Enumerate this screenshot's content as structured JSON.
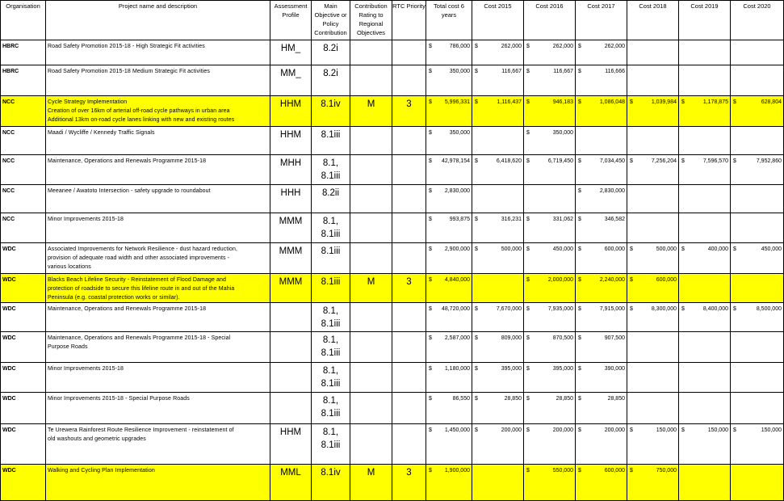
{
  "headers": {
    "organisation": "Organisation",
    "project": "Project name and description",
    "assessment": "Assessment Profile",
    "objective": "Main Objective or Policy Contribution",
    "contribution": "Contribution Rating to Regional Objectives",
    "priority": "RTC Priority",
    "total": "Total cost 6 years",
    "cost2015": "Cost 2015",
    "cost2016": "Cost 2016",
    "cost2017": "Cost 2017",
    "cost2018": "Cost 2018",
    "cost2019": "Cost 2019",
    "cost2020": "Cost 2020"
  },
  "currency_symbol": "$",
  "highlight_color": "#ffff00",
  "rows": [
    {
      "org": "HBRC",
      "desc": [
        "Road Safety Promotion 2015-18 - High Strategic Fit activities"
      ],
      "assessment": "HM_",
      "objective": [
        "8.2i"
      ],
      "contribution": "",
      "priority": "",
      "total": "786,000",
      "c2015": "262,000",
      "c2016": "262,000",
      "c2017": "262,000",
      "c2018": "",
      "c2019": "",
      "c2020": "",
      "highlight": false,
      "h": 31
    },
    {
      "org": "HBRC",
      "desc": [
        "Road Safety Promotion 2015-18 Medium Strategic Fit activities"
      ],
      "assessment": "MM_",
      "objective": [
        "8.2i"
      ],
      "contribution": "",
      "priority": "",
      "total": "350,000",
      "c2015": "116,667",
      "c2016": "116,667",
      "c2017": "116,666",
      "c2018": "",
      "c2019": "",
      "c2020": "",
      "highlight": false,
      "h": 38
    },
    {
      "org": "NCC",
      "desc": [
        "Cycle Strategy Implementation",
        "Creation of over 16km of arterial off-road cycle pathways in urban area",
        "Additional 13km on-road cycle lanes linking with new and existing routes"
      ],
      "assessment": "HHM",
      "objective": [
        "8.1iv"
      ],
      "contribution": "M",
      "priority": "3",
      "total": "5,996,331",
      "c2015": "1,116,437",
      "c2016": "946,183",
      "c2017": "1,086,048",
      "c2018": "1,039,984",
      "c2019": "1,178,875",
      "c2020": "628,804",
      "highlight": true,
      "h": 38
    },
    {
      "org": "NCC",
      "desc": [
        "Maadi / Wycliffe / Kennedy Traffic Signals"
      ],
      "assessment": "HHM",
      "objective": [
        "8.1iii"
      ],
      "contribution": "",
      "priority": "",
      "total": "350,000",
      "c2015": "",
      "c2016": "350,000",
      "c2017": "",
      "c2018": "",
      "c2019": "",
      "c2020": "",
      "highlight": false,
      "h": 35
    },
    {
      "org": "NCC",
      "desc": [
        "Maintenance, Operations and Renewals Programme 2015-18"
      ],
      "assessment": "MHH",
      "objective": [
        "8.1,",
        "8.1iii"
      ],
      "contribution": "",
      "priority": "",
      "total": "42,978,154",
      "c2015": "6,418,620",
      "c2016": "6,719,450",
      "c2017": "7,034,450",
      "c2018": "7,256,204",
      "c2019": "7,596,570",
      "c2020": "7,952,860",
      "highlight": false,
      "h": 37
    },
    {
      "org": "NCC",
      "desc": [
        "Meeanee / Awatoto Intersection - safety upgrade to roundabout"
      ],
      "assessment": "HHH",
      "objective": [
        "8.2ii"
      ],
      "contribution": "",
      "priority": "",
      "total": "2,830,000",
      "c2015": "",
      "c2016": "",
      "c2017": "2,830,000",
      "c2018": "",
      "c2019": "",
      "c2020": "",
      "highlight": false,
      "h": 35
    },
    {
      "org": "NCC",
      "desc": [
        "Minor Improvements 2015-18"
      ],
      "assessment": "MMM",
      "objective": [
        "8.1,",
        "8.1iii"
      ],
      "contribution": "",
      "priority": "",
      "total": "993,875",
      "c2015": "316,231",
      "c2016": "331,062",
      "c2017": "346,582",
      "c2018": "",
      "c2019": "",
      "c2020": "",
      "highlight": false,
      "h": 37
    },
    {
      "org": "WDC",
      "desc": [
        "Associated Improvements for Network Resilience - dust hazard reduction,",
        "provision of adequate road width and other associated improvements -",
        "various locations"
      ],
      "assessment": "MMM",
      "objective": [
        "8.1iii"
      ],
      "contribution": "",
      "priority": "",
      "total": "2,900,000",
      "c2015": "500,000",
      "c2016": "450,000",
      "c2017": "600,000",
      "c2018": "500,000",
      "c2019": "400,000",
      "c2020": "450,000",
      "highlight": false,
      "h": 38
    },
    {
      "org": "WDC",
      "desc": [
        "Blacks Beach Lifeline Security - Reinstatement of Flood Damage and",
        "protection of roadside to secure this lifeline route in and out of the Mahia",
        "Peninsula (e.g. coastal protection works or similar)."
      ],
      "assessment": "MMM",
      "objective": [
        "8.1iii"
      ],
      "contribution": "M",
      "priority": "3",
      "total": "4,840,000",
      "c2015": "",
      "c2016": "2,000,000",
      "c2017": "2,240,000",
      "c2018": "600,000",
      "c2019": "",
      "c2020": "",
      "highlight": true,
      "h": 34
    },
    {
      "org": "WDC",
      "desc": [
        "Maintenance, Operations and Renewals Programme 2015-18"
      ],
      "assessment": "",
      "objective": [
        "8.1,",
        "8.1iii"
      ],
      "contribution": "",
      "priority": "",
      "total": "48,720,000",
      "c2015": "7,670,000",
      "c2016": "7,935,000",
      "c2017": "7,915,000",
      "c2018": "8,300,000",
      "c2019": "8,400,000",
      "c2020": "8,500,000",
      "highlight": false,
      "h": 36
    },
    {
      "org": "WDC",
      "desc": [
        "Maintenance, Operations and Renewals Programme 2015-18 - Special",
        "Purpose Roads"
      ],
      "assessment": "",
      "objective": [
        "8.1,",
        "8.1iii"
      ],
      "contribution": "",
      "priority": "",
      "total": "2,587,000",
      "c2015": "809,000",
      "c2016": "870,500",
      "c2017": "907,500",
      "c2018": "",
      "c2019": "",
      "c2020": "",
      "highlight": false,
      "h": 38
    },
    {
      "org": "WDC",
      "desc": [
        "Minor Improvements 2015-18"
      ],
      "assessment": "",
      "objective": [
        "8.1,",
        "8.1iii"
      ],
      "contribution": "",
      "priority": "",
      "total": "1,180,000",
      "c2015": "395,000",
      "c2016": "395,000",
      "c2017": "390,000",
      "c2018": "",
      "c2019": "",
      "c2020": "",
      "highlight": false,
      "h": 37
    },
    {
      "org": "WDC",
      "desc": [
        "Minor Improvements 2015-18 - Special Purpose Roads"
      ],
      "assessment": "",
      "objective": [
        "8.1,",
        "8.1iii"
      ],
      "contribution": "",
      "priority": "",
      "total": "86,550",
      "c2015": "28,850",
      "c2016": "28,850",
      "c2017": "28,850",
      "c2018": "",
      "c2019": "",
      "c2020": "",
      "highlight": false,
      "h": 39
    },
    {
      "org": "WDC",
      "desc": [
        "Te Urewera Rainforest Route Resilience Improvement - reinstatement of",
        "old washouts and geometric upgrades"
      ],
      "assessment": "HHM",
      "objective": [
        "8.1,",
        "8.1iii"
      ],
      "contribution": "",
      "priority": "",
      "total": "1,450,000",
      "c2015": "200,000",
      "c2016": "200,000",
      "c2017": "200,000",
      "c2018": "150,000",
      "c2019": "150,000",
      "c2020": "150,000",
      "highlight": false,
      "h": 50
    },
    {
      "org": "WDC",
      "desc": [
        "Walking and Cycling Plan Implementation"
      ],
      "assessment": "MML",
      "objective": [
        "8.1iv"
      ],
      "contribution": "M",
      "priority": "3",
      "total": "1,900,000",
      "c2015": "",
      "c2016": "550,000",
      "c2017": "600,000",
      "c2018": "750,000",
      "c2019": "",
      "c2020": "",
      "highlight": true,
      "h": 45
    }
  ]
}
